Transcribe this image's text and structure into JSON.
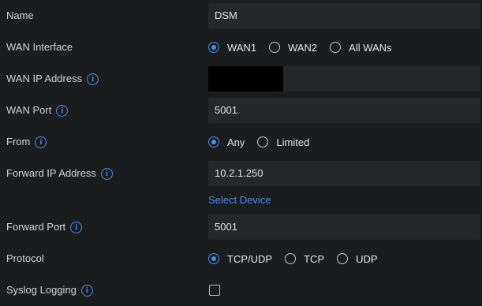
{
  "name": {
    "label": "Name",
    "value": "DSM"
  },
  "wan_interface": {
    "label": "WAN Interface",
    "options": [
      {
        "label": "WAN1",
        "checked": true
      },
      {
        "label": "WAN2",
        "checked": false
      },
      {
        "label": "All WANs",
        "checked": false
      }
    ]
  },
  "wan_ip": {
    "label": "WAN IP Address",
    "value_redacted": true
  },
  "wan_port": {
    "label": "WAN Port",
    "value": "5001"
  },
  "from": {
    "label": "From",
    "options": [
      {
        "label": "Any",
        "checked": true
      },
      {
        "label": "Limited",
        "checked": false
      }
    ]
  },
  "forward_ip": {
    "label": "Forward IP Address",
    "value": "10.2.1.250",
    "select_device": "Select Device"
  },
  "forward_port": {
    "label": "Forward Port",
    "value": "5001"
  },
  "protocol": {
    "label": "Protocol",
    "options": [
      {
        "label": "TCP/UDP",
        "checked": true
      },
      {
        "label": "TCP",
        "checked": false
      },
      {
        "label": "UDP",
        "checked": false
      }
    ]
  },
  "syslog": {
    "label": "Syslog Logging",
    "checked": false
  },
  "colors": {
    "background": "#1b1c1e",
    "field": "#26272b",
    "accent": "#4c8df0"
  },
  "info_icon_glyph": "i"
}
